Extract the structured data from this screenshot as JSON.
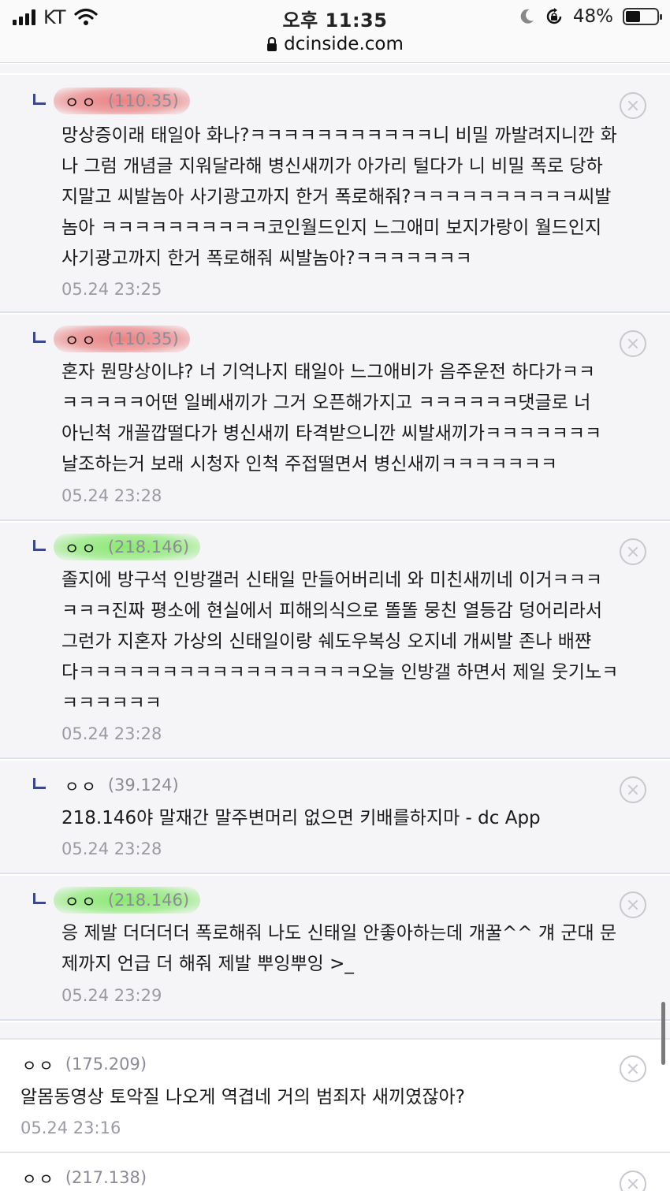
{
  "status_bar": {
    "carrier": "KT",
    "time": "오후 11:35",
    "url": "dcinside.com",
    "battery": "48%",
    "battery_level": 0.48,
    "icons": [
      "signal-icon",
      "wifi-icon",
      "lock-icon",
      "moon-icon",
      "rotation-lock-icon",
      "battery-icon"
    ]
  },
  "comments": [
    {
      "nick": "ㅇㅇ",
      "ip": "(110.35)",
      "highlight": "red",
      "lines": [
        "망상증이래 태일아 화나?ㅋㅋㅋㅋㅋㅋㅋㅋㅋㅋㅋ니 비밀 까발려지니깐 화",
        "나 그럼 개념글 지워달라해 병신새끼가 아가리 털다가 니 비밀 폭로 당하",
        "지말고 씨발놈아 사기광고까지 한거 폭로해줘?ㅋㅋㅋㅋㅋㅋㅋㅋㅋㅋ씨발",
        "놈아 ㅋㅋㅋㅋㅋㅋㅋㅋㅋㅋ코인월드인지 느그애미 보지가랑이 월드인지",
        "사기광고까지 한거 폭로해줘 씨발놈아?ㅋㅋㅋㅋㅋㅋㅋ"
      ],
      "date": "05.24 23:25"
    },
    {
      "nick": "ㅇㅇ",
      "ip": "(110.35)",
      "highlight": "red",
      "lines": [
        "혼자 뭔망상이냐? 너 기억나지 태일아 느그애비가 음주운전 하다가ㅋㅋ",
        "ㅋㅋㅋㅋㅋ어떤 일베새끼가 그거 오픈해가지고 ㅋㅋㅋㅋㅋㅋ댓글로 너",
        "아닌척 개꼴깝떨다가 병신새끼 타격받으니깐 씨발새끼가ㅋㅋㅋㅋㅋㅋㅋ",
        "날조하는거 보래 시청자 인척 주접떨면서 병신새끼ㅋㅋㅋㅋㅋㅋㅋ"
      ],
      "date": "05.24 23:28"
    },
    {
      "nick": "ㅇㅇ",
      "ip": "(218.146)",
      "highlight": "green",
      "lines": [
        "졸지에 방구석 인방갤러 신태일 만들어버리네 와 미친새끼네 이거ㅋㅋㅋ",
        "ㅋㅋㅋ진짜 평소에 현실에서 피해의식으로 똘똘 뭉친 열등감 덩어리라서",
        "그런가 지혼자 가상의 신태일이랑 쉐도우복싱 오지네 개씨발 존나 배쨘",
        "다ㅋㅋㅋㅋㅋㅋㅋㅋㅋㅋㅋㅋㅋㅋㅋㅋㅋ오늘 인방갤 하면서 제일 웃기노ㅋ",
        "ㅋㅋㅋㅋㅋㅋ"
      ],
      "date": "05.24 23:28"
    },
    {
      "nick": "ㅇㅇ",
      "ip": "(39.124)",
      "highlight": "none",
      "lines": [
        "218.146야 말재간 말주변머리 없으면 키배를하지마 - dc App"
      ],
      "date": "05.24 23:28"
    },
    {
      "nick": "ㅇㅇ",
      "ip": "(218.146)",
      "highlight": "green",
      "lines": [
        "응 제발 더더더더 폭로해줘 나도 신태일 안좋아하는데 개꿀^^ 걔 군대 문",
        "제까지 언급 더 해줘 제발 뿌잉뿌잉 >_"
      ],
      "date": "05.24 23:29"
    },
    {
      "nick": "ㅇㅇ",
      "ip": "(175.209)",
      "highlight": "none",
      "lines": [
        "알몸동영상 토악질 나오게 역겹네 거의 범죄자 새끼였잖아?"
      ],
      "date": "05.24 23:16"
    },
    {
      "nick": "ㅇㅇ",
      "ip": "(217.138)",
      "highlight": "none",
      "lines": [],
      "date": ""
    }
  ]
}
